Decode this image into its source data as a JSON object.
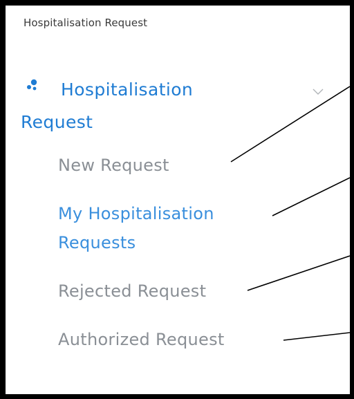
{
  "header": {
    "title": "Hospitalisation Request"
  },
  "menu": {
    "parent_label": "Hospitalisation Request",
    "parent_icon": "dots-icon",
    "chevron_icon": "chevron-down-icon",
    "accent_color": "#1f7cd3",
    "items": [
      {
        "label": "New Request",
        "active": false
      },
      {
        "label": "My Hospitalisation Requests",
        "active": true
      },
      {
        "label": "Rejected Request",
        "active": false
      },
      {
        "label": "Authorized Request",
        "active": false
      }
    ]
  }
}
